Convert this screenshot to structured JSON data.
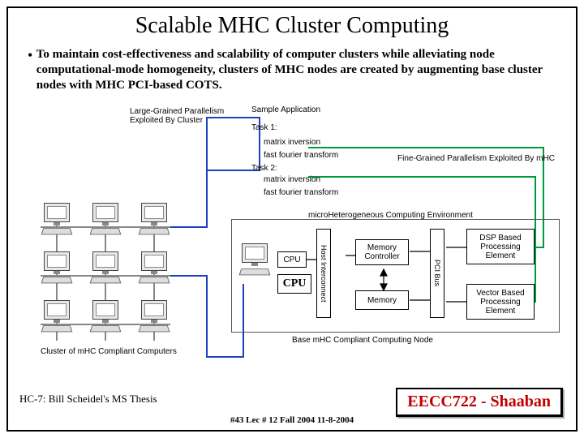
{
  "title": "Scalable MHC Cluster Computing",
  "bullet": "To maintain cost-effectiveness and scalability of computer clusters  while alleviating node computational-mode homogeneity,  clusters  of  MHC  nodes are created by augmenting base cluster nodes with MHC PCI-based COTS.",
  "labels": {
    "large_grained": "Large-Grained Parallelism\nExploited By Cluster",
    "sample_app": "Sample Application",
    "task1": "Task 1:",
    "matrix_inv": "matrix inversion",
    "fft": "fast fourier transform",
    "task2": "Task 2:",
    "matrix_inv2": "matrix inversion",
    "fft2": "fast fourier transform",
    "fine_grained": "Fine-Grained Parallelism Exploited By mHC",
    "mhc_env": "microHeterogeneous Computing Environment",
    "cpu_small": "CPU",
    "host_interconnect": "Host Interconnect",
    "mem_ctrl": "Memory\nController",
    "memory": "Memory",
    "pci_bus": "PCI Bus",
    "dsp": "DSP Based\nProcessing\nElement",
    "vector": "Vector Based\nProcessing\nElement",
    "cluster_caption": "Cluster of mHC Compliant Computers",
    "base_node": "Base mHC Compliant Computing Node"
  },
  "cpu_big": "CPU",
  "footer": {
    "left": "HC-7: Bill Scheidel's MS Thesis",
    "mid": "#43   Lec # 12   Fall 2004  11-8-2004",
    "right": "EECC722 - Shaaban"
  }
}
